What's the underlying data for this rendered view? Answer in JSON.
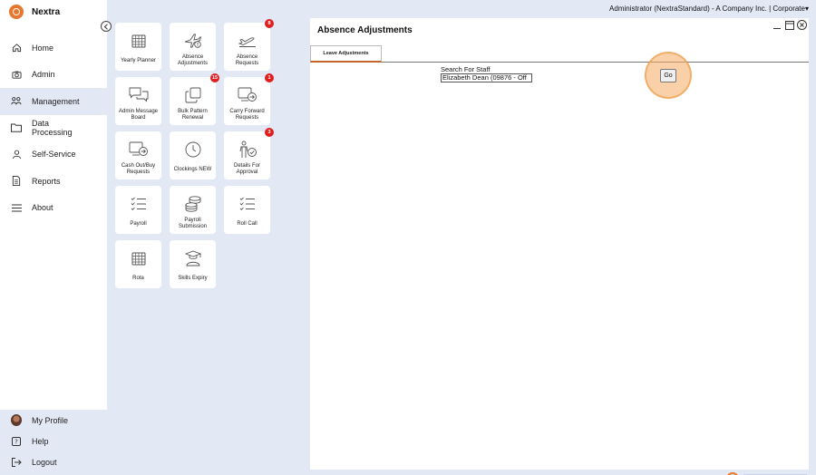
{
  "brand": {
    "name": "Nextra"
  },
  "header": {
    "user_info": "Administrator (NextraStandard) - A Company Inc. | Corporate▾"
  },
  "nav": {
    "home": "Home",
    "admin": "Admin",
    "management": "Management",
    "data_processing_line1": "Data",
    "data_processing_line2": "Processing",
    "self_service": "Self-Service",
    "reports": "Reports",
    "about": "About"
  },
  "bottom": {
    "profile": "My Profile",
    "help": "Help",
    "logout": "Logout"
  },
  "tiles": {
    "yearly_planner": {
      "line1": "Yearly Planner"
    },
    "absence_adjustments": {
      "line1": "Absence",
      "line2": "Adjustments"
    },
    "absence_requests": {
      "line1": "Absence",
      "line2": "Requests",
      "badge": "8"
    },
    "admin_message_board": {
      "line1": "Admin Message",
      "line2": "Board"
    },
    "bulk_pattern_renewal": {
      "line1": "Bulk Pattern",
      "line2": "Renewal",
      "badge": "15"
    },
    "carry_forward_requests": {
      "line1": "Carry Forward",
      "line2": "Requests",
      "badge": "1"
    },
    "cash_out_buy_requests": {
      "line1": "Cash Out/Buy",
      "line2": "Requests"
    },
    "clockings_new": {
      "line1": "Clockings NEW"
    },
    "details_for_approval": {
      "line1": "Details For",
      "line2": "Approval",
      "badge": "3"
    },
    "payroll": {
      "line1": "Payroll"
    },
    "payroll_submission": {
      "line1": "Payroll",
      "line2": "Submission"
    },
    "roll_call": {
      "line1": "Roll Call"
    },
    "rota": {
      "line1": "Rota"
    },
    "skills_expiry": {
      "line1": "Skills Expiry"
    }
  },
  "panel": {
    "title": "Absence Adjustments",
    "tab": "Leave Adjustments",
    "search_label": "Search For Staff",
    "search_value": "Elizabeth  Dean (09876 - Off",
    "go_label": "Go"
  },
  "colors": {
    "accent": "#e8772e",
    "badge": "#e02020",
    "background": "#e3e8f5"
  }
}
